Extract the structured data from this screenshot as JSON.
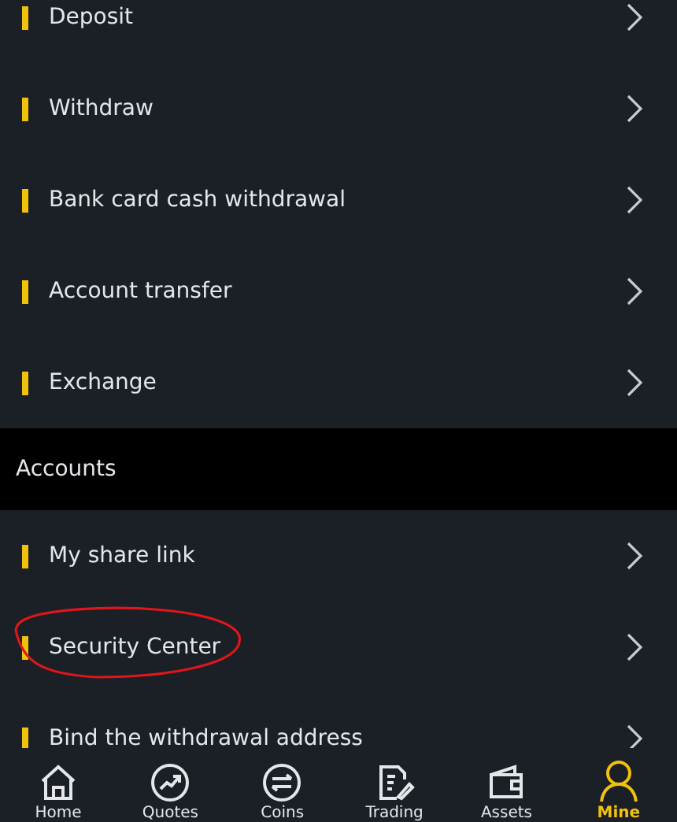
{
  "sections": [
    {
      "items": [
        {
          "label": "Deposit",
          "highlighted": false
        },
        {
          "label": "Withdraw",
          "highlighted": false
        },
        {
          "label": "Bank card cash withdrawal",
          "highlighted": false
        },
        {
          "label": "Account transfer",
          "highlighted": false
        },
        {
          "label": "Exchange",
          "highlighted": false
        }
      ]
    },
    {
      "title": "Accounts",
      "items": [
        {
          "label": "My share link",
          "highlighted": false
        },
        {
          "label": "Security Center",
          "highlighted": true
        },
        {
          "label": "Bind the withdrawal address",
          "highlighted": false
        }
      ]
    }
  ],
  "nav": [
    {
      "label": "Home",
      "kind": "home",
      "selected": false
    },
    {
      "label": "Quotes",
      "kind": "quotes",
      "selected": false
    },
    {
      "label": "Coins",
      "kind": "coins",
      "selected": false
    },
    {
      "label": "Trading",
      "kind": "trading",
      "selected": false
    },
    {
      "label": "Assets",
      "kind": "assets",
      "selected": false
    },
    {
      "label": "Mine",
      "kind": "mine",
      "selected": true
    }
  ]
}
